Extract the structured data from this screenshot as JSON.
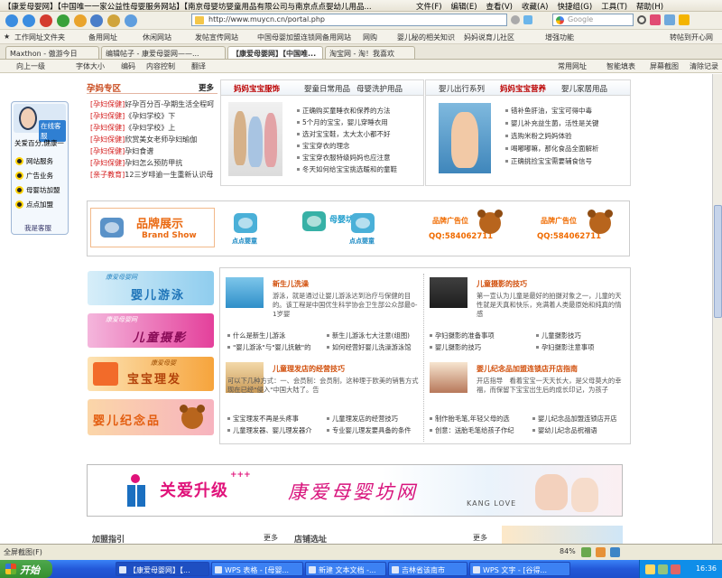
{
  "browser": {
    "title": "【康爱母婴网】【中国唯一一家公益性母婴服务网站】【南京母婴坊婴童用品有限公司与南京点点婴幼儿用品...",
    "menu": [
      "文件(F)",
      "编辑(E)",
      "查看(V)",
      "收藏(A)",
      "快捷组(G)",
      "工具(T)",
      "帮助(H)"
    ],
    "address": "http://www.muycn.cn/portal.php",
    "search_placeholder": "Google",
    "favorites": [
      "工作网址文件夹",
      "备用网址",
      "休闲网站",
      "发帖宣传网站",
      "中国母婴加盟连锁网备用网站",
      "网购",
      "婴儿秘的相关知识",
      "妈妈说育儿社区"
    ],
    "favorites_right": [
      "增强功能",
      "转帖到开心网"
    ],
    "tabs": [
      "Maxthon - 傲游今日",
      "编辑帖子 - 康爱母婴网——...",
      "【康爱母婴网】【中国唯...",
      "淘宝网 - 淘！我喜欢"
    ],
    "tools": [
      "向上一级",
      "字体大小",
      "编码",
      "内容控制",
      "翻译"
    ],
    "tools_right": [
      "常用网址",
      "智能填表",
      "屏幕截图",
      "清除记录"
    ],
    "status_left": "全屏截图(F)",
    "zoom": "84%",
    "taskbar": {
      "start": "开始",
      "tasks": [
        "【康爱母婴网】【...",
        "WPS 表格 - [母婴...",
        "新建 文本文档 -...",
        "吉林省该南市",
        "WPS 文字 - [谷得..."
      ],
      "clock": "16:36"
    }
  },
  "service": {
    "online": "在线客服",
    "slogan": "关爱百分,健康一",
    "items": [
      "网站服务",
      "广告业务",
      "母婴坊加盟",
      "点点加盟"
    ],
    "footer": "我是客服"
  },
  "pregnancy": {
    "title": "孕妈专区",
    "more": "更多",
    "items": [
      {
        "tag": "[孕妇保健]",
        "text": "好孕百分百-孕期生活全程呵"
      },
      {
        "tag": "[孕妇保健]",
        "text": "《孕妇学校》下"
      },
      {
        "tag": "[孕妇保健]",
        "text": "《孕妇学校》上"
      },
      {
        "tag": "[孕妇保健]",
        "text": "欣赏美女老师孕妇瑜伽"
      },
      {
        "tag": "[孕妇保健]",
        "text": "孕妇食谱"
      },
      {
        "tag": "[孕妇保健]",
        "text": "孕妇怎么预防甲抗"
      },
      {
        "tag": "[亲子教育]",
        "text": "12三岁啡逾一生重新认识母"
      }
    ]
  },
  "clothing": {
    "tabs": [
      "妈妈宝宝服饰",
      "婴童日常用品",
      "母婴洗护用品"
    ],
    "items": [
      "正确购买童睡衣和保养的方法",
      "5个月的宝宝，婴儿穿睡衣用",
      "选对宝宝鞋，太大太小都不好",
      "宝宝穿衣的理念",
      "宝宝穿衣服特级妈妈也应注意",
      "冬天如何给宝宝挑选暖和的童鞋"
    ]
  },
  "outing": {
    "tabs": [
      "婴儿出行系列",
      "妈妈宝宝营养",
      "婴儿家居用品"
    ],
    "items": [
      "错补鱼肝油，宝宝可得中毒",
      "婴儿补充益生菌，活性是关键",
      "选购米粉之妈妈体验",
      "喝嘟嘟嘛，那化食品全面解析",
      "正确挑捡宝宝需要辅食信号"
    ]
  },
  "logos": {
    "brand_cn": "品牌展示",
    "brand_en": "Brand Show",
    "logo1": "点点婴童",
    "logo2": "母婴坊",
    "logo3": "点点婴童",
    "ad_title": "品牌广告位",
    "ad_qq": "QQ:584062711"
  },
  "left_banners": [
    {
      "top": "康爱母婴网",
      "big": "婴儿游泳"
    },
    {
      "top": "康爱母婴网",
      "big": "儿童摄影"
    },
    {
      "top": "康爱母婴",
      "big": "宝宝理发"
    },
    {
      "top": "",
      "big": "婴儿纪念品"
    }
  ],
  "news": {
    "swim": {
      "title": "新生儿洗澡",
      "desc": "游泳，就是通过让婴儿游泳达到治疗与保健的目的。该工程是中国优生科学协会卫生部公众部最0-1岁婴",
      "links": [
        "什么是新生儿游泳",
        "新生儿游泳七大注意(组图)",
        "\"婴儿游泳\"与\"婴儿抚触\"的",
        "如何经营好婴儿洗澡游泳馆"
      ]
    },
    "photo": {
      "title": "儿童摄影的技巧",
      "desc": "第一宣认为儿童是最好的拍摄对象之一，儿童的天性就是天真和快乐，充满着人类最原始和纯真的情感",
      "links": [
        "孕妇摄影的准备事项",
        "儿童摄影技巧",
        "婴儿摄影的技巧",
        "孕妇摄影注意事项"
      ]
    },
    "salon": {
      "title": "儿童理发店的经营技巧",
      "desc": "可以下几种方式：一、会员制：会员制，这种理于欧美的销售方式现在已经\"侵入\"中国大陆了。告",
      "links": [
        "宝宝理发不再是头疼事",
        "儿童理发店的经营技巧",
        "儿童理发器、婴儿理发器介",
        "专业婴儿理发要具备的条件"
      ]
    },
    "keepsake": {
      "title": "婴儿纪念品加盟连锁店开店指南",
      "desc": "开店指导　看着宝宝一天天长大，是父母莫大的幸福，而保留下宝宝出生后的成长印记，为孩子",
      "links": [
        "制作胎毛笔,年轻父母的选",
        "婴儿纪念品加盟连锁店开店",
        "创意：送胎毛笔给孩子作纪",
        "婴幼儿纪念品祝福语"
      ]
    }
  },
  "banner": {
    "slogan": "关爱升级",
    "plus": "+++",
    "name": "康爱母婴坊网",
    "eng": "KANG LOVE"
  },
  "bottom": {
    "left_title": "加盟指引",
    "right_title": "店铺选址",
    "more": "更多"
  },
  "colors": {
    "accent": "#d41b1b",
    "title_orange": "#d14e0a",
    "link_blue": "#2f7fd2",
    "pink": "#e0127a"
  }
}
